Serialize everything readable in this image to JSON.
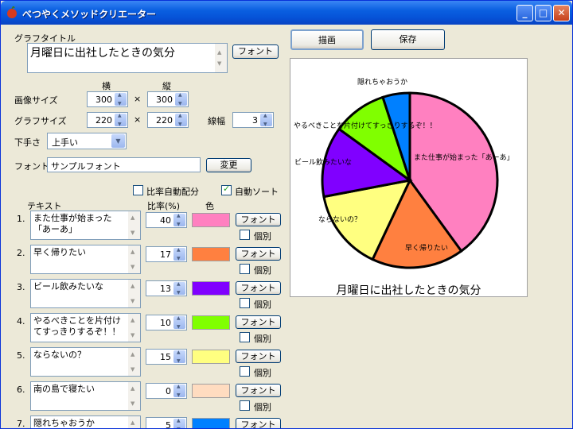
{
  "window": {
    "title": "べつやくメソッドクリエーター"
  },
  "labels": {
    "graph_title": "グラフタイトル",
    "width": "横",
    "height": "縦",
    "image_size": "画像サイズ",
    "graph_size": "グラフサイズ",
    "times": "×",
    "line_width": "線幅",
    "clumsiness": "下手さ",
    "font": "フォント",
    "auto_ratio": "比率自動配分",
    "auto_sort": "自動ソート",
    "text_col": "テキスト",
    "ratio_col": "比率(%)",
    "color_col": "色"
  },
  "graph_title": "月曜日に出社したときの気分",
  "buttons": {
    "title_font": "フォント",
    "draw": "描画",
    "save": "保存",
    "change": "変更",
    "font": "フォント",
    "individual": "個別"
  },
  "image_size": {
    "w": "300",
    "h": "300"
  },
  "graph_size": {
    "w": "220",
    "h": "220"
  },
  "line_width": "3",
  "clumsiness": "上手い",
  "font_name": "サンプルフォント",
  "auto_ratio": false,
  "auto_sort": true,
  "rows": [
    {
      "no": "1.",
      "text": "また仕事が始まった「あーあ」",
      "ratio": "40",
      "color": "#ff80c0"
    },
    {
      "no": "2.",
      "text": "早く帰りたい",
      "ratio": "17",
      "color": "#ff8040"
    },
    {
      "no": "3.",
      "text": "ビール飲みたいな",
      "ratio": "13",
      "color": "#8000ff"
    },
    {
      "no": "4.",
      "text": "やるべきことを片付けてすっきりするぞ！！",
      "ratio": "10",
      "color": "#80ff00"
    },
    {
      "no": "5.",
      "text": "ならないの？",
      "ratio": "15",
      "color": "#ffff80"
    },
    {
      "no": "6.",
      "text": "南の島で寝たい",
      "ratio": "0",
      "color": "#ffdcc0"
    },
    {
      "no": "7.",
      "text": "隠れちゃおうか",
      "ratio": "5",
      "color": "#0080ff"
    }
  ],
  "chart_data": {
    "type": "pie",
    "title": "月曜日に出社したときの気分",
    "labels": [
      "また仕事が始まった「あーあ」",
      "早く帰りたい",
      "ならないの？",
      "ビール飲みたいな",
      "やるべきことを片付けてすっきりするぞ！！",
      "隠れちゃおうか"
    ],
    "values": [
      40,
      17,
      15,
      13,
      10,
      5
    ],
    "colors": [
      "#ff80c0",
      "#ff8040",
      "#ffff80",
      "#8000ff",
      "#80ff00",
      "#0080ff"
    ]
  },
  "pie_labels": {
    "s0": "また仕事が始まった「あーあ」",
    "s1": "早く帰りたい",
    "s2": "ならないの？",
    "s3": "ビール飲みたいな",
    "s4": "やるべきことを片付けてすっきりするぞ！！",
    "s5": "隠れちゃおうか"
  }
}
